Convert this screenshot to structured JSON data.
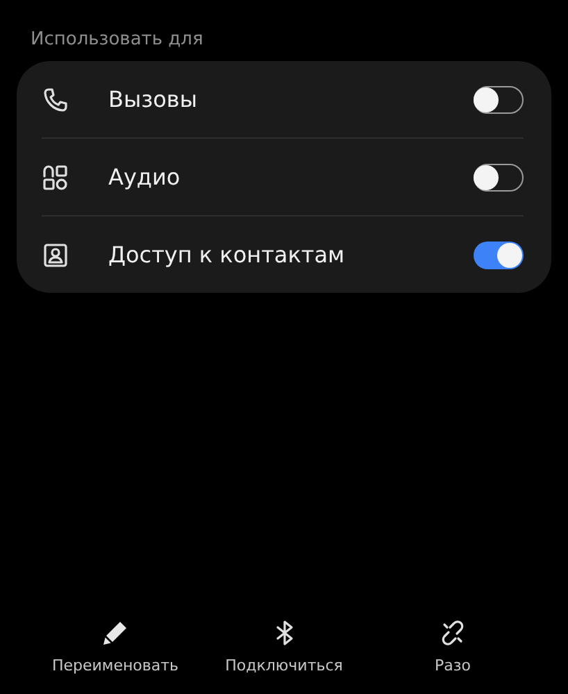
{
  "section": {
    "title": "Использовать для"
  },
  "options": [
    {
      "label": "Вызовы",
      "on": false
    },
    {
      "label": "Аудио",
      "on": false
    },
    {
      "label": "Доступ к контактам",
      "on": true
    }
  ],
  "bottom_actions": [
    {
      "label": "Переименовать"
    },
    {
      "label": "Подключиться"
    },
    {
      "label": "Разо"
    }
  ]
}
